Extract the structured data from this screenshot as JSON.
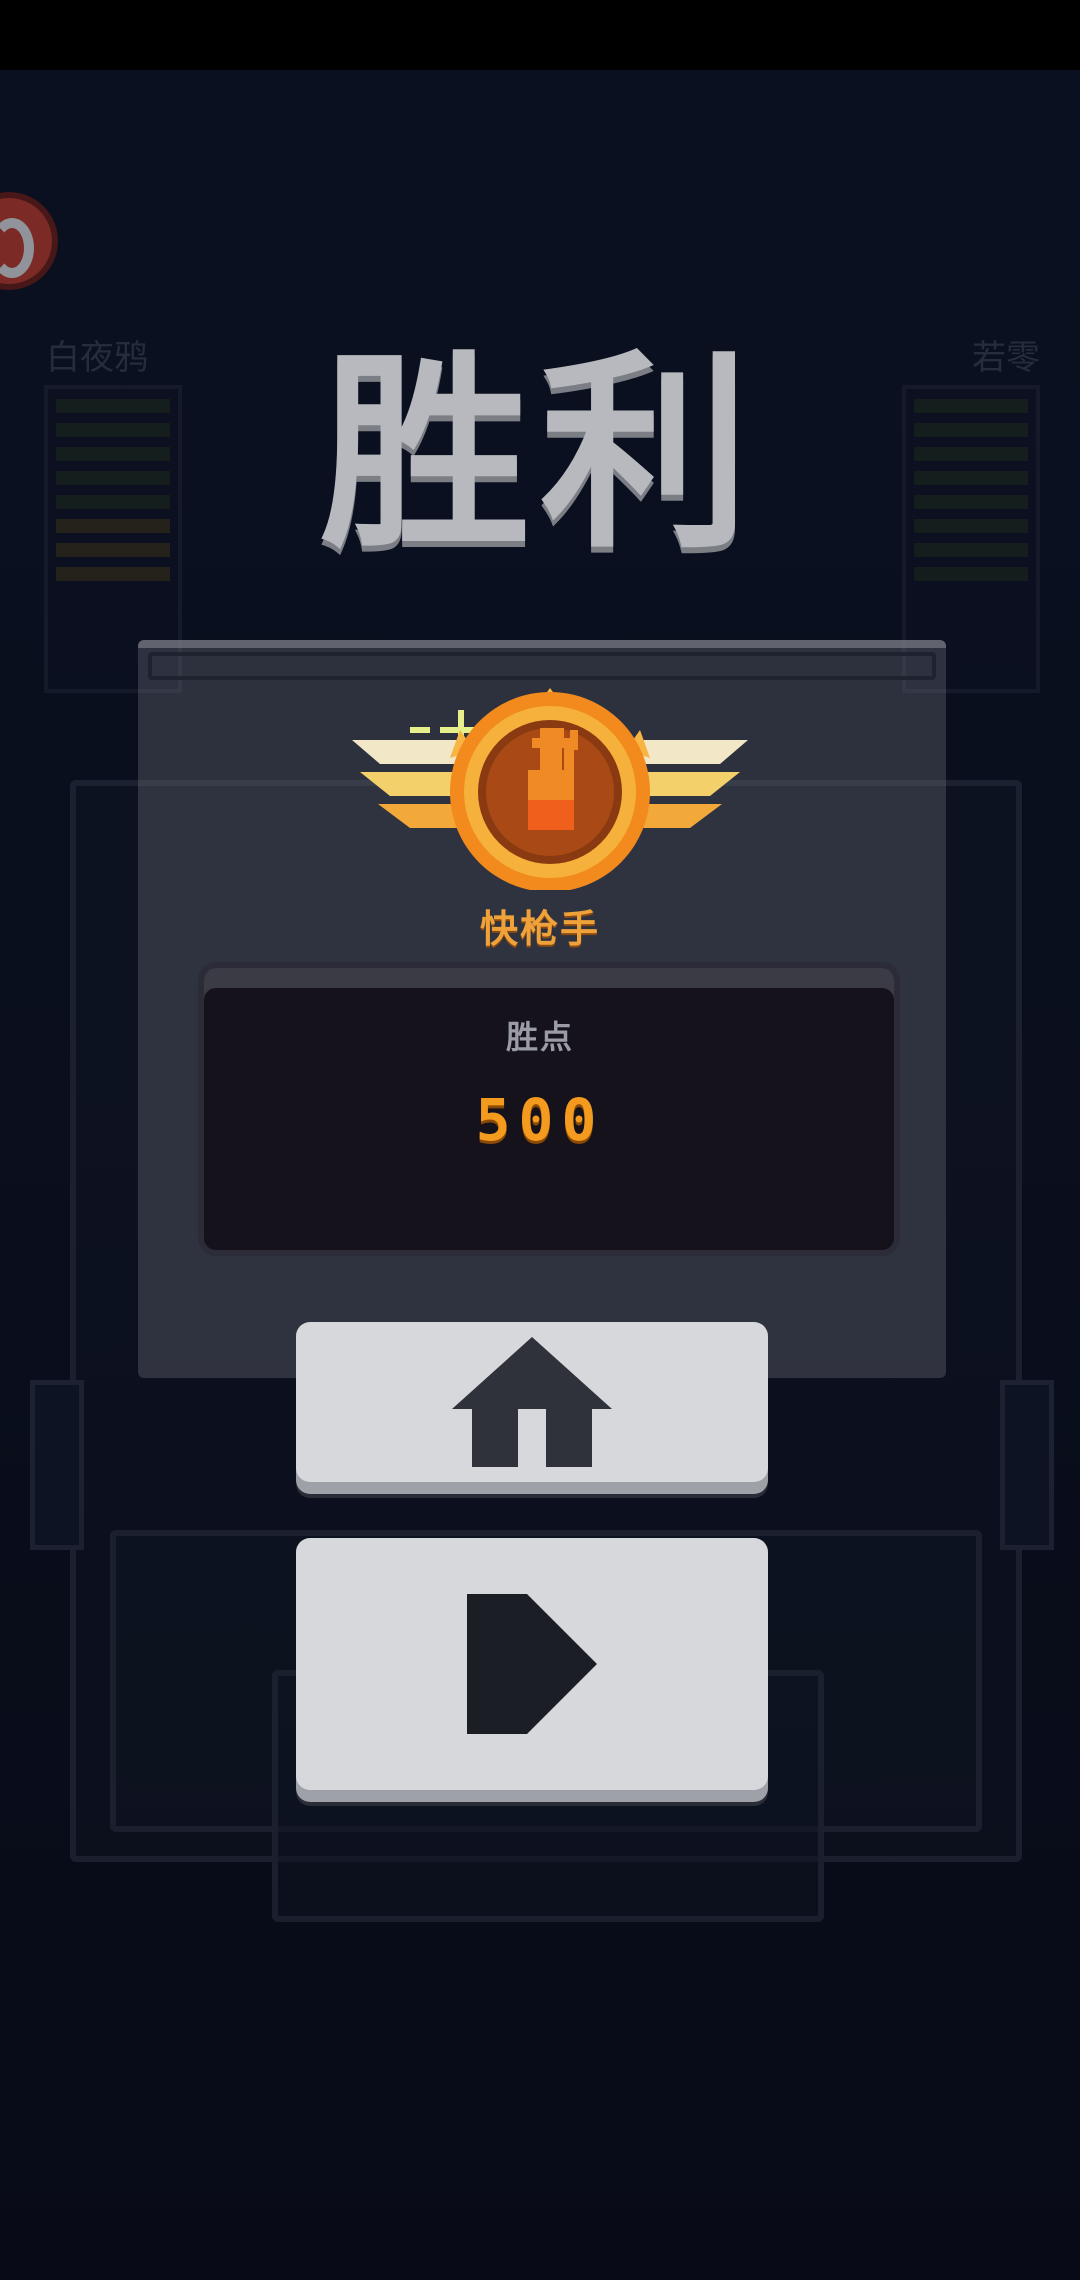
{
  "scene": {
    "player_left": "白夜鸦",
    "player_right": "若零"
  },
  "result": {
    "title": "胜利",
    "medal": {
      "icon": "gunslinger-medal-icon",
      "label": "快枪手"
    },
    "points_label": "胜点",
    "points_value": "500"
  },
  "buttons": {
    "home_icon": "home-icon",
    "play_icon": "play-icon"
  },
  "colors": {
    "accent_orange": "#f39a1f",
    "button_face": "#d7d8db",
    "title": "#b8b9be"
  }
}
